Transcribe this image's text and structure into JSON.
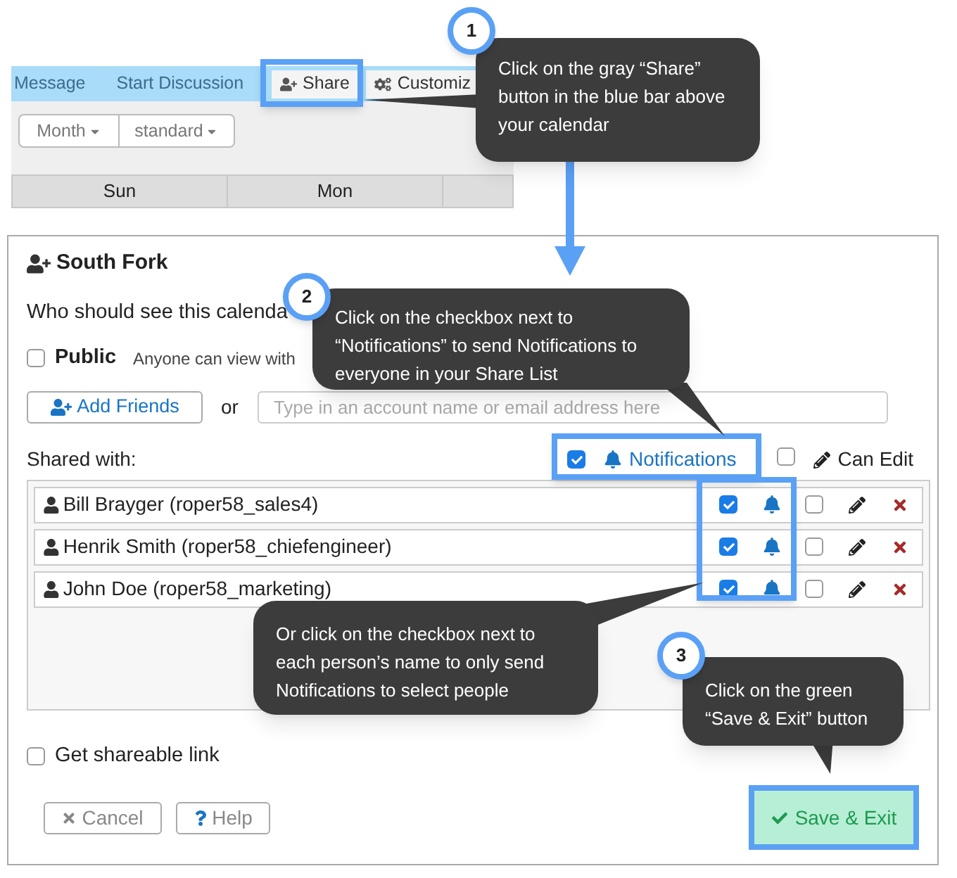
{
  "calendar_toolbar": {
    "items": [
      {
        "label": "Message",
        "kind": "link"
      },
      {
        "label": "Start Discussion",
        "kind": "link"
      },
      {
        "label": "Share",
        "kind": "button"
      },
      {
        "label": "Customiz",
        "kind": "button"
      }
    ]
  },
  "view_buttons": [
    {
      "label": "Month"
    },
    {
      "label": "standard"
    }
  ],
  "day_headers": [
    "Sun",
    "Mon"
  ],
  "dialog": {
    "title": "South Fork",
    "question": "Who should see this calenda",
    "public": {
      "label": "Public",
      "checked": false,
      "description": "Anyone can view with"
    },
    "add_friends": "Add Friends",
    "or": "or",
    "search": {
      "placeholder": "Type in an account name or email address here"
    },
    "shared_label": "Shared with:",
    "notifications": {
      "label": "Notifications",
      "checked": true
    },
    "can_edit": {
      "label": "Can Edit",
      "checked": false
    },
    "people": [
      {
        "name": "Bill Brayger (roper58_sales4)",
        "notify": true,
        "can_edit": false
      },
      {
        "name": "Henrik Smith (roper58_chiefengineer)",
        "notify": true,
        "can_edit": false
      },
      {
        "name": "John Doe (roper58_marketing)",
        "notify": true,
        "can_edit": false
      }
    ],
    "shareable_link": {
      "label": "Get shareable link",
      "checked": false
    },
    "buttons": {
      "cancel": "Cancel",
      "help": "Help",
      "save": "Save & Exit"
    }
  },
  "callouts": [
    {
      "number": "1",
      "text": "Click on the gray “Share” button in the blue bar above your calendar"
    },
    {
      "number": "2",
      "text": "Click on the checkbox next to “Notifications” to send Notifications to everyone in your Share List"
    },
    {
      "text": "Or click on the checkbox next to each person’s name to only send Notifications to select people"
    },
    {
      "number": "3",
      "text": "Click on the green “Save & Exit” button"
    }
  ]
}
